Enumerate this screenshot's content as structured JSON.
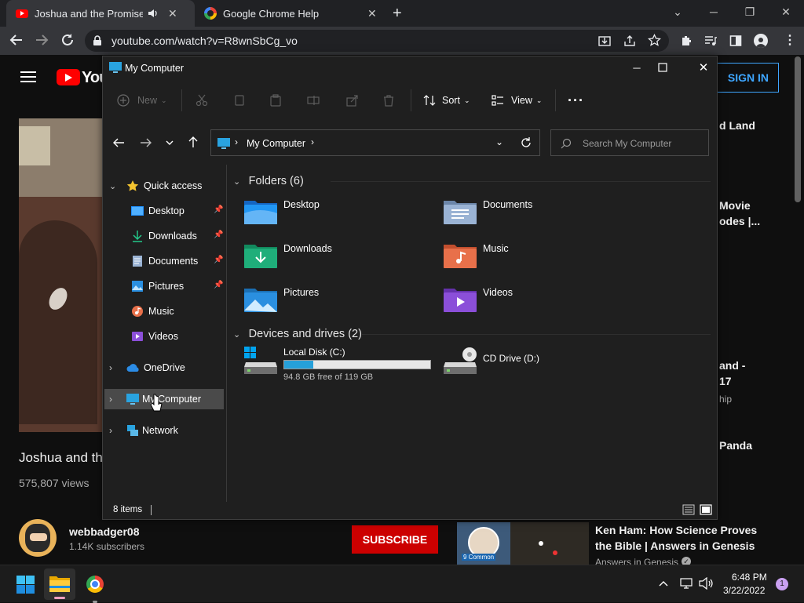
{
  "browser": {
    "tabs": [
      {
        "title": "Joshua and the Promised Land",
        "icon": "youtube-icon"
      },
      {
        "title": "Google Chrome Help",
        "icon": "google-icon"
      }
    ],
    "url": "youtube.com/watch?v=R8wnSbCg_vo"
  },
  "youtube": {
    "sign_in": "SIGN IN",
    "logo_text": "YouTube",
    "video_title": "Joshua and the Promised Land",
    "views": "575,807 views",
    "channel": "webbadger08",
    "subscribers": "1.14K subscribers",
    "subscribe": "SUBSCRIBE",
    "sidebar": [
      {
        "text": "d Land"
      },
      {
        "text": "Movie"
      },
      {
        "text": "odes |..."
      },
      {
        "text": "and -"
      },
      {
        "text": "17"
      },
      {
        "text": "hip"
      },
      {
        "text": "Panda"
      }
    ],
    "recommended": {
      "title": "Ken Ham: How Science Proves the Bible | Answers in Genesis",
      "channel": "Answers in Genesis",
      "thumb_text": "9 Common"
    }
  },
  "explorer": {
    "title": "My Computer",
    "commands": {
      "new": "New",
      "sort": "Sort",
      "view": "View"
    },
    "address": "My Computer",
    "search_placeholder": "Search My Computer",
    "nav": {
      "quick_access": "Quick access",
      "items": [
        {
          "label": "Desktop",
          "icon": "desktop-icon",
          "pinned": true
        },
        {
          "label": "Downloads",
          "icon": "downloads-icon",
          "pinned": true
        },
        {
          "label": "Documents",
          "icon": "documents-icon",
          "pinned": true
        },
        {
          "label": "Pictures",
          "icon": "pictures-icon",
          "pinned": true
        },
        {
          "label": "Music",
          "icon": "music-icon",
          "pinned": false
        },
        {
          "label": "Videos",
          "icon": "videos-icon",
          "pinned": false
        }
      ],
      "onedrive": "OneDrive",
      "mycomputer": "My Computer",
      "network": "Network"
    },
    "folders_header": "Folders (6)",
    "folders": [
      {
        "label": "Desktop",
        "icon": "desktop-folder-icon",
        "color": "#1e90ff"
      },
      {
        "label": "Documents",
        "icon": "documents-folder-icon",
        "color": "#8aa4c8"
      },
      {
        "label": "Downloads",
        "icon": "downloads-folder-icon",
        "color": "#1fae7a"
      },
      {
        "label": "Music",
        "icon": "music-folder-icon",
        "color": "#e8704a"
      },
      {
        "label": "Pictures",
        "icon": "pictures-folder-icon",
        "color": "#2a8fe0"
      },
      {
        "label": "Videos",
        "icon": "videos-folder-icon",
        "color": "#8b4fd9"
      }
    ],
    "drives_header": "Devices and drives (2)",
    "drives": [
      {
        "label": "Local Disk (C:)",
        "free": "94.8 GB free of 119 GB",
        "used_fraction": 0.2,
        "icon": "local-disk-icon"
      },
      {
        "label": "CD Drive (D:)",
        "icon": "cd-drive-icon"
      }
    ],
    "status": "8 items"
  },
  "taskbar": {
    "time": "6:48 PM",
    "date": "3/22/2022",
    "notification_count": "1"
  }
}
